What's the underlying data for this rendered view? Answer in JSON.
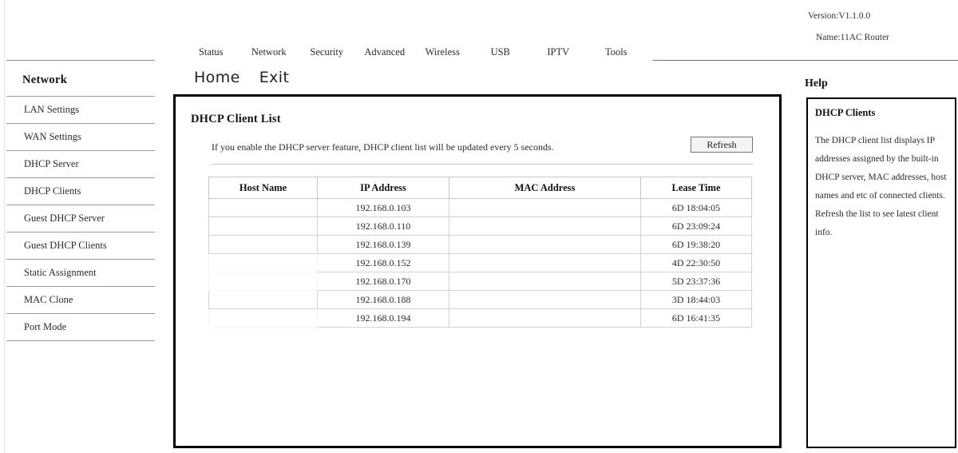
{
  "header": {
    "version_label": "Version:V1.1.0.0",
    "name_label": "Name:11AC Router"
  },
  "top_nav": {
    "items": [
      {
        "label": "Status"
      },
      {
        "label": "Network"
      },
      {
        "label": "Security"
      },
      {
        "label": "Advanced"
      },
      {
        "label": "Wireless"
      },
      {
        "label": "USB"
      },
      {
        "label": "IPTV"
      },
      {
        "label": "Tools"
      }
    ]
  },
  "quick_links": {
    "home_label": "Home",
    "exit_label": "Exit"
  },
  "sidebar": {
    "title": "Network",
    "items": [
      {
        "label": "LAN Settings"
      },
      {
        "label": "WAN Settings"
      },
      {
        "label": "DHCP Server"
      },
      {
        "label": "DHCP Clients"
      },
      {
        "label": "Guest DHCP Server"
      },
      {
        "label": "Guest DHCP Clients"
      },
      {
        "label": "Static Assignment"
      },
      {
        "label": "MAC Clone"
      },
      {
        "label": "Port Mode"
      }
    ]
  },
  "main": {
    "title": "DHCP Client List",
    "description": "If you enable the DHCP server feature, DHCP client list will be updated every 5 seconds.",
    "refresh_label": "Refresh",
    "table": {
      "columns": [
        "Host Name",
        "IP Address",
        "MAC Address",
        "Lease Time"
      ],
      "rows": [
        {
          "host_name": "",
          "ip_address": "192.168.0.103",
          "mac_address": "",
          "lease_time": "6D 18:04:05"
        },
        {
          "host_name": "",
          "ip_address": "192.168.0.110",
          "mac_address": "",
          "lease_time": "6D 23:09:24"
        },
        {
          "host_name": "",
          "ip_address": "192.168.0.139",
          "mac_address": "",
          "lease_time": "6D 19:38:20"
        },
        {
          "host_name": "",
          "ip_address": "192.168.0.152",
          "mac_address": "",
          "lease_time": "4D 22:30:50"
        },
        {
          "host_name": "",
          "ip_address": "192.168.0.170",
          "mac_address": "",
          "lease_time": "5D 23:37:36"
        },
        {
          "host_name": "",
          "ip_address": "192.168.0.188",
          "mac_address": "",
          "lease_time": "3D 18:44:03"
        },
        {
          "host_name": "",
          "ip_address": "192.168.0.194",
          "mac_address": "",
          "lease_time": "6D 16:41:35"
        }
      ]
    }
  },
  "help": {
    "title": "Help",
    "section_title": "DHCP Clients",
    "body": "The DHCP client list displays IP addresses assigned by the built-in DHCP server, MAC addresses, host names and etc of connected clients. Refresh the list to see latest client info."
  }
}
